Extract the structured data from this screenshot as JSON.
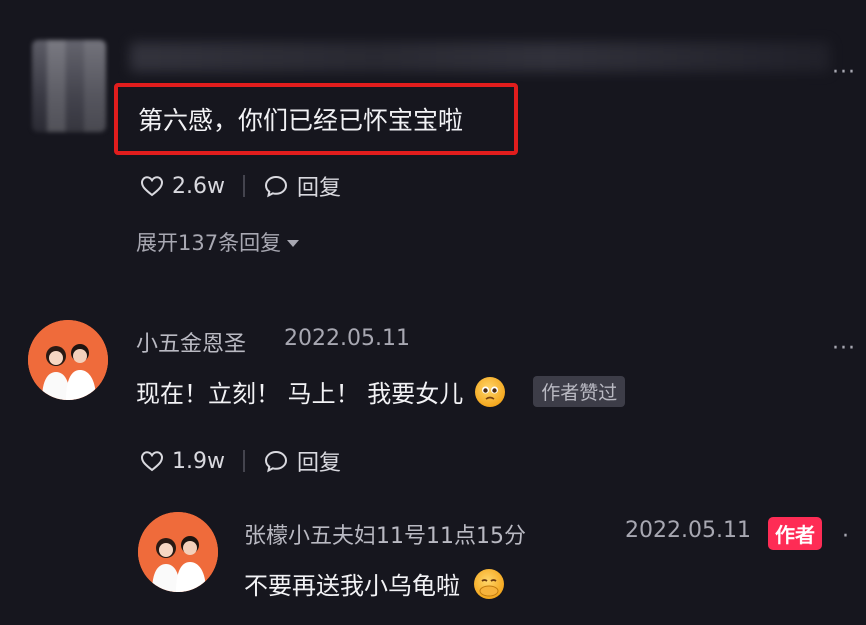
{
  "comment1": {
    "text": "第六感，你们已经已怀宝宝啦",
    "likes": "2.6w",
    "reply_label": "回复",
    "expand_label": "展开137条回复"
  },
  "comment2": {
    "username": "小五金恩圣",
    "date": "2022.05.11",
    "text": "现在！立刻！ 马上！ 我要女儿",
    "emoji": "pleading-face",
    "author_liked_badge": "作者赞过",
    "likes": "1.9w",
    "reply_label": "回复"
  },
  "reply1": {
    "username": "张檬小五夫妇11号11点15分",
    "date": "2022.05.11",
    "author_badge": "作者",
    "text": "不要再送我小乌龟啦",
    "emoji": "pleading-hands-face"
  },
  "colors": {
    "background": "#16161e",
    "highlight_border": "#e11d1d",
    "author_badge": "#fe2c55"
  }
}
